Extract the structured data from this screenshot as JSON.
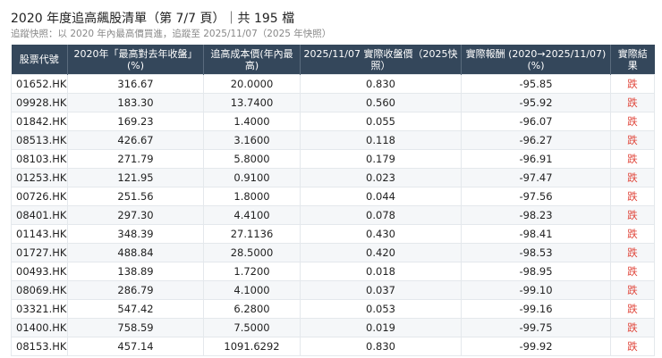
{
  "header": {
    "title": "2020 年度追高飆股清單（第 7/7 頁）｜共 195 檔",
    "subtitle": "追蹤快照：以 2020 年內最高價買進，追蹤至 2025/11/07（2025 年快照）"
  },
  "table": {
    "columns": [
      "股票代號",
      "2020年「最高對去年收盤」(%)",
      "追高成本價(年內最高)",
      "2025/11/07 實際收盤價（2025快照）",
      "實際報酬 (2020→2025/11/07) (%)",
      "實際結果"
    ],
    "rows": [
      [
        "01652.HK",
        "316.67",
        "20.0000",
        "0.830",
        "-95.85",
        "跌"
      ],
      [
        "09928.HK",
        "183.30",
        "13.7400",
        "0.560",
        "-95.92",
        "跌"
      ],
      [
        "01842.HK",
        "169.23",
        "1.4000",
        "0.055",
        "-96.07",
        "跌"
      ],
      [
        "08513.HK",
        "426.67",
        "3.1600",
        "0.118",
        "-96.27",
        "跌"
      ],
      [
        "08103.HK",
        "271.79",
        "5.8000",
        "0.179",
        "-96.91",
        "跌"
      ],
      [
        "01253.HK",
        "121.95",
        "0.9100",
        "0.023",
        "-97.47",
        "跌"
      ],
      [
        "00726.HK",
        "251.56",
        "1.8000",
        "0.044",
        "-97.56",
        "跌"
      ],
      [
        "08401.HK",
        "297.30",
        "4.4100",
        "0.078",
        "-98.23",
        "跌"
      ],
      [
        "01143.HK",
        "348.39",
        "27.1136",
        "0.430",
        "-98.41",
        "跌"
      ],
      [
        "01727.HK",
        "488.84",
        "28.5000",
        "0.420",
        "-98.53",
        "跌"
      ],
      [
        "00493.HK",
        "138.89",
        "1.7200",
        "0.018",
        "-98.95",
        "跌"
      ],
      [
        "08069.HK",
        "286.79",
        "4.1000",
        "0.037",
        "-99.10",
        "跌"
      ],
      [
        "03321.HK",
        "547.42",
        "6.2800",
        "0.053",
        "-99.16",
        "跌"
      ],
      [
        "01400.HK",
        "758.59",
        "7.5000",
        "0.019",
        "-99.75",
        "跌"
      ],
      [
        "08153.HK",
        "457.14",
        "1091.6292",
        "0.830",
        "-99.92",
        "跌"
      ]
    ]
  },
  "colors": {
    "header_bg": "#34475b",
    "down": "#e0463b"
  }
}
